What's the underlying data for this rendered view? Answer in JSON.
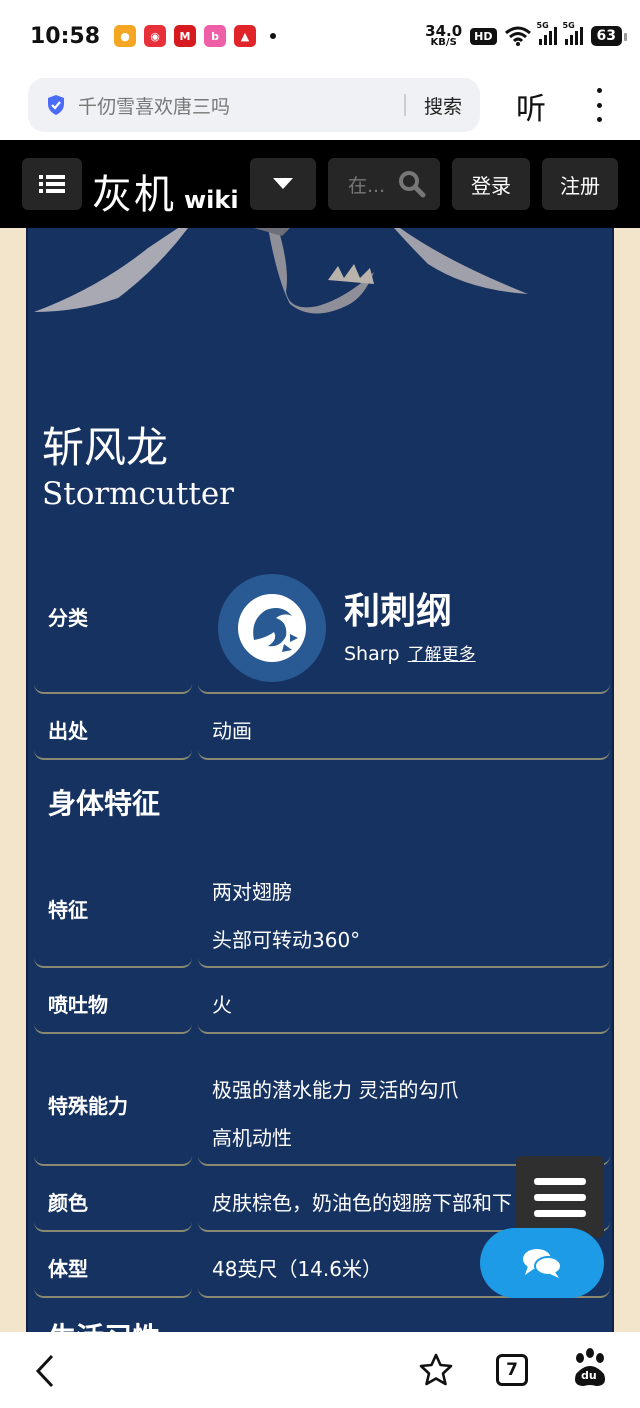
{
  "status_bar": {
    "time": "10:58",
    "net_speed_value": "34.0",
    "net_speed_unit": "KB/S",
    "hd_label": "HD",
    "signal_label_1": "5G",
    "signal_label_2": "5G",
    "battery": "63"
  },
  "browser": {
    "url_text": "千仞雪喜欢唐三吗",
    "search_label": "搜索",
    "listen_label": "听"
  },
  "wiki_nav": {
    "logo_cn": "灰机",
    "logo_wiki": "wiki",
    "search_placeholder": "在...",
    "login": "登录",
    "register": "注册"
  },
  "infobox": {
    "title_cn": "斩风龙",
    "title_en": "Stormcutter",
    "classification": {
      "label": "分类",
      "class_name": "利刺纲",
      "class_en": "Sharp",
      "learn_more": "了解更多"
    },
    "origin": {
      "label": "出处",
      "value": "动画"
    },
    "section_body": "身体特征",
    "features": {
      "label": "特征",
      "line1": "两对翅膀",
      "line2": "头部可转动360°"
    },
    "spit": {
      "label": "喷吐物",
      "value": "火"
    },
    "abilities": {
      "label": "特殊能力",
      "line1": "极强的潜水能力 灵活的勾爪",
      "line2": "高机动性"
    },
    "color": {
      "label": "颜色",
      "value": "皮肤棕色，奶油色的翅膀下部和下"
    },
    "size": {
      "label": "体型",
      "value": "48英尺（14.6米）"
    },
    "section_habits": "生活习性"
  },
  "bottom_bar": {
    "tab_count": "7",
    "baidu_label": "du"
  },
  "colors": {
    "panel_bg": "#163261",
    "page_bg": "#f3e4cc",
    "nav_bg": "#000000",
    "accent_blue": "#1e9be6"
  }
}
